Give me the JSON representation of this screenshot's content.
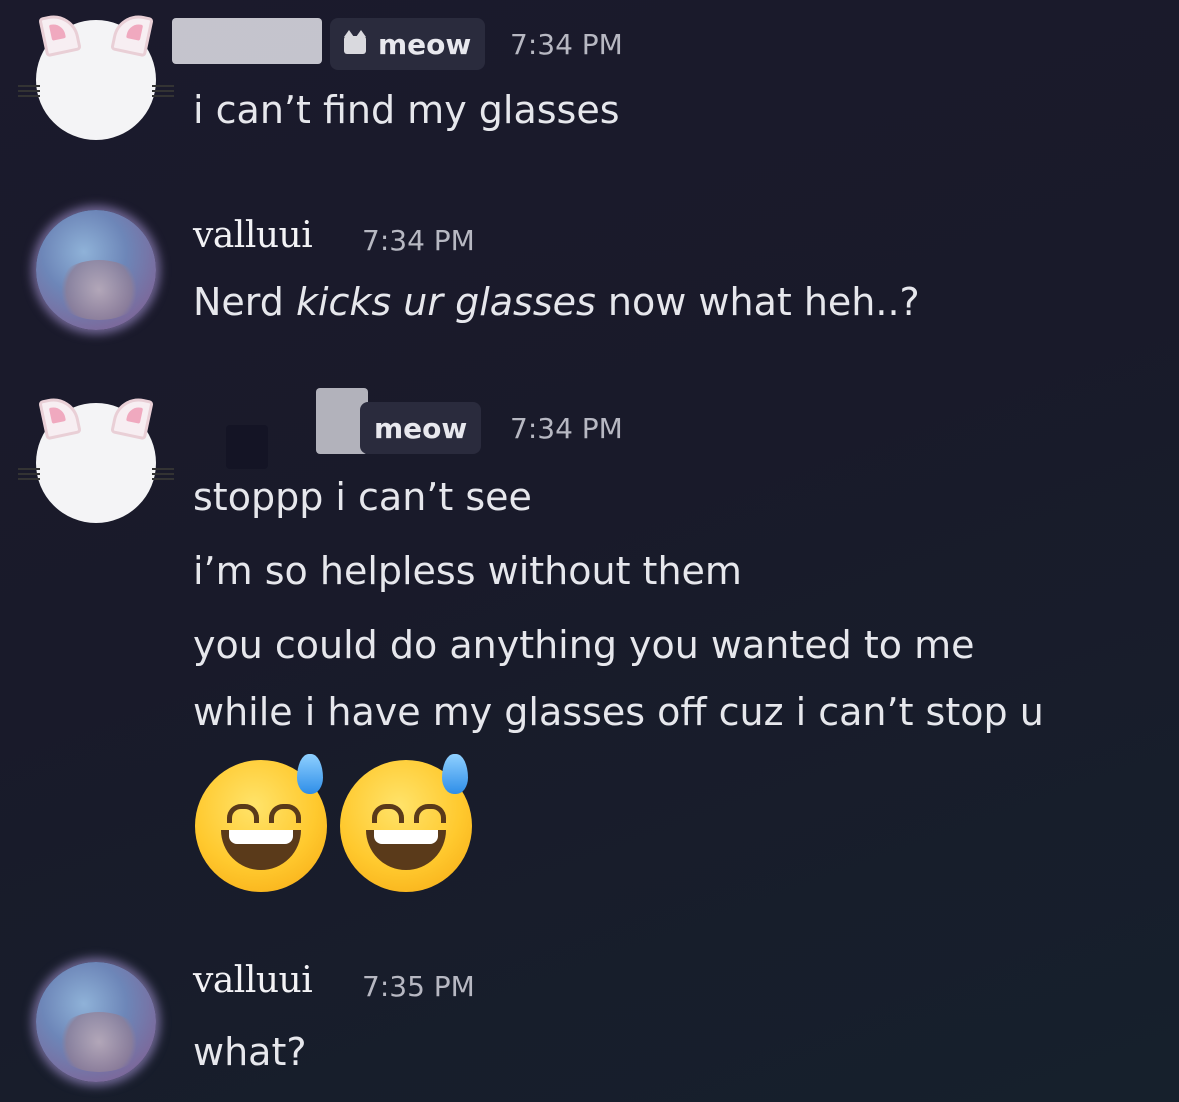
{
  "messages": [
    {
      "author": "",
      "tag": "meow",
      "time": "7:34 PM",
      "lines": [
        "i can’t find my glasses"
      ]
    },
    {
      "author": "valluui",
      "time": "7:34 PM",
      "parts": [
        "Nerd ",
        "kicks ur glasses",
        " now what heh..?"
      ]
    },
    {
      "author": "",
      "tag": "meow",
      "time": "7:34 PM",
      "lines": [
        "stoppp i can’t see",
        "i’m so helpless without them",
        "you could do anything you wanted to me",
        "while i have my glasses off cuz i can’t stop u"
      ],
      "emoji": [
        "grinning-face-with-sweat",
        "grinning-face-with-sweat"
      ]
    },
    {
      "author": "valluui",
      "time": "7:35 PM",
      "lines": [
        "what?"
      ]
    }
  ],
  "icons": {
    "tag_icon": "pixel-cat-icon",
    "avatar_1": "white-cat-ear-avatar",
    "avatar_2": "blue-purple-avatar"
  },
  "colors": {
    "background": "#1a1b2c",
    "tag_background": "#2a2b3d",
    "text": "#e6e7ec",
    "timestamp": "#b7b8c2"
  }
}
